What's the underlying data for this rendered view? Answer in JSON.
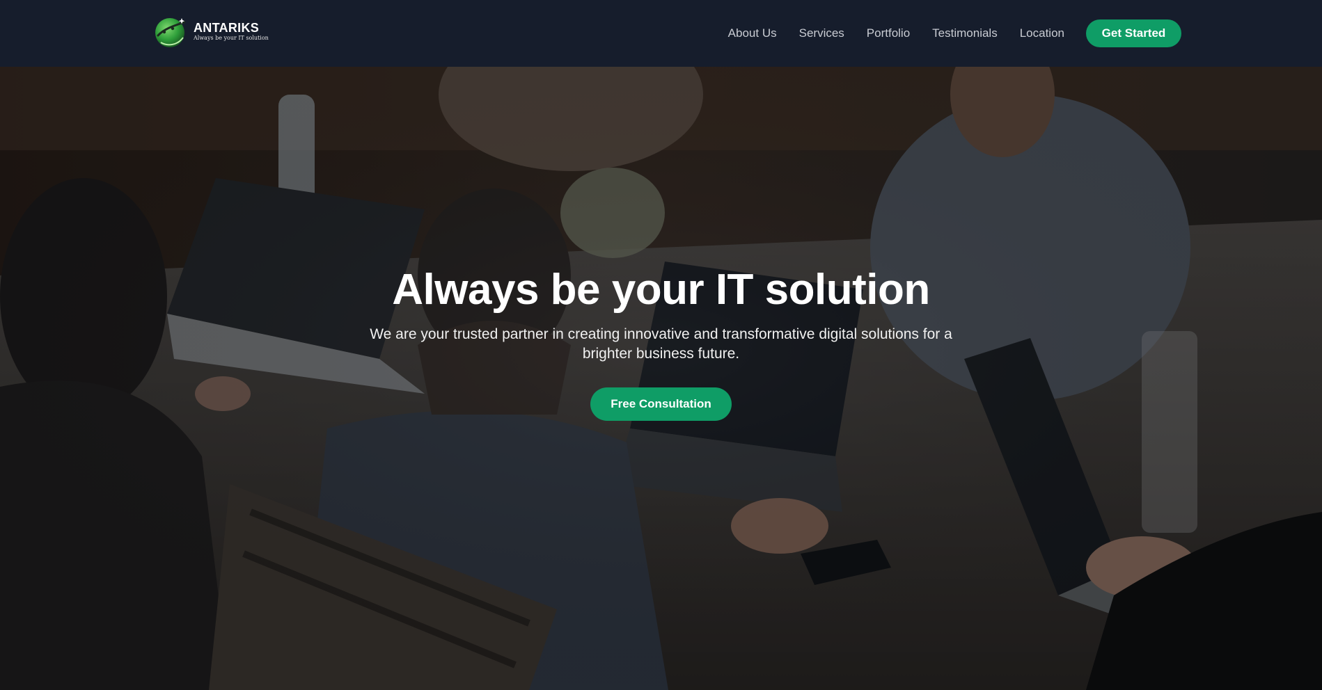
{
  "brand": {
    "name": "ANTARIKS",
    "tagline": "Always be your IT solution",
    "logo_icon": "planet-orbit-icon"
  },
  "nav": {
    "links": [
      {
        "label": "About Us"
      },
      {
        "label": "Services"
      },
      {
        "label": "Portfolio"
      },
      {
        "label": "Testimonials"
      },
      {
        "label": "Location"
      }
    ],
    "cta_label": "Get Started"
  },
  "hero": {
    "title": "Always be your IT solution",
    "subtitle": "We are your trusted partner in creating innovative and transformative digital solutions for a brighter business future.",
    "cta_label": "Free Consultation",
    "background_image": "team-working-on-laptops-photo"
  },
  "colors": {
    "accent": "#0f9d66",
    "navbar_bg": "#161d2c",
    "nav_link": "#c9ccd3",
    "text_light": "#ffffff"
  }
}
